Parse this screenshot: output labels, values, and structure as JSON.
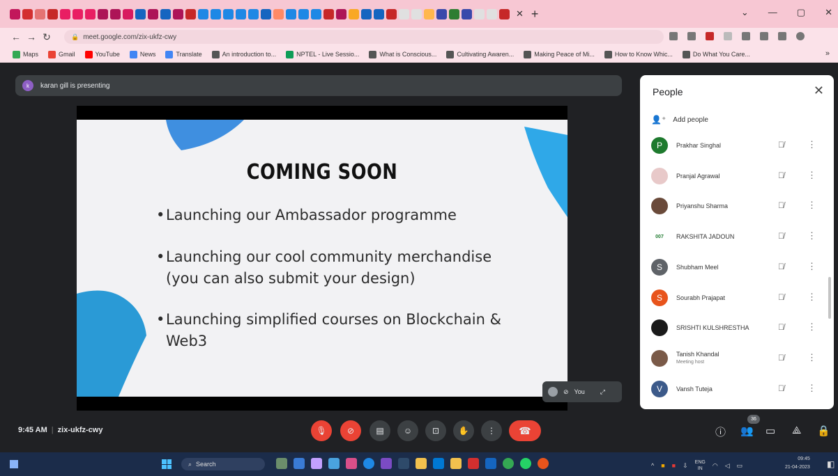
{
  "browser": {
    "tab_label": "",
    "omnibox_url": "meet.google.com/zix-ukfz-cwy",
    "bookmarks": [
      {
        "label": "Maps"
      },
      {
        "label": "Gmail"
      },
      {
        "label": "YouTube"
      },
      {
        "label": "News"
      },
      {
        "label": "Translate"
      },
      {
        "label": "An introduction to..."
      },
      {
        "label": "NPTEL - Live Sessio..."
      },
      {
        "label": "What is Conscious..."
      },
      {
        "label": "Cultivating Awaren..."
      },
      {
        "label": "Making Peace of Mi..."
      },
      {
        "label": "How to Know Whic..."
      },
      {
        "label": "Do What You Care..."
      }
    ]
  },
  "meet": {
    "presenting_text": "karan gill is presenting",
    "presenter_initial": "k",
    "slide": {
      "title": "COMING SOON",
      "bullets": [
        "Launching our Ambassador programme",
        "Launching our cool community merchandise (you can also submit your design)",
        "Launching simplified courses on Blockchain & Web3"
      ],
      "bullet_2_line1": "Launching our cool community merchandise",
      "bullet_2_line2": "(you can also submit your design)",
      "bullet_3_line1": "Launching simplified courses on Blockchain &",
      "bullet_3_line2": "Web3"
    },
    "self_tile_label": "You",
    "time": "9:45 AM",
    "meeting_code": "zix-ukfz-cwy",
    "participant_count": "36"
  },
  "people_panel": {
    "title": "People",
    "add_people_label": "Add people",
    "participants": [
      {
        "name": "Prakhar Singhal",
        "initial": "P",
        "color": "#1e7a2e",
        "subtitle": ""
      },
      {
        "name": "Pranjal Agrawal",
        "initial": "",
        "color": "#e8c9c9",
        "subtitle": ""
      },
      {
        "name": "Priyanshu Sharma",
        "initial": "",
        "color": "#6a4a3a",
        "subtitle": ""
      },
      {
        "name": "RAKSHITA JADOUN",
        "initial": "007",
        "color": "#ffffff",
        "subtitle": ""
      },
      {
        "name": "Shubham Meel",
        "initial": "S",
        "color": "#5f6368",
        "subtitle": ""
      },
      {
        "name": "Sourabh Prajapat",
        "initial": "S",
        "color": "#e8541c",
        "subtitle": ""
      },
      {
        "name": "SRISHTI KULSHRESTHA",
        "initial": "",
        "color": "#1a1a1a",
        "subtitle": ""
      },
      {
        "name": "Tanish Khandal",
        "initial": "",
        "color": "#7a5a48",
        "subtitle": "Meeting host"
      },
      {
        "name": "Vansh Tuteja",
        "initial": "V",
        "color": "#3c5a8a",
        "subtitle": ""
      }
    ]
  },
  "taskbar": {
    "search_label": "Search",
    "language": "ENG",
    "region": "IN",
    "clock_time": "09:45",
    "clock_date": "21-04-2023"
  },
  "colors": {
    "meet_bg": "#202124",
    "end_call_red": "#ea4335",
    "tabstrip_pink": "#f7c7d3"
  }
}
